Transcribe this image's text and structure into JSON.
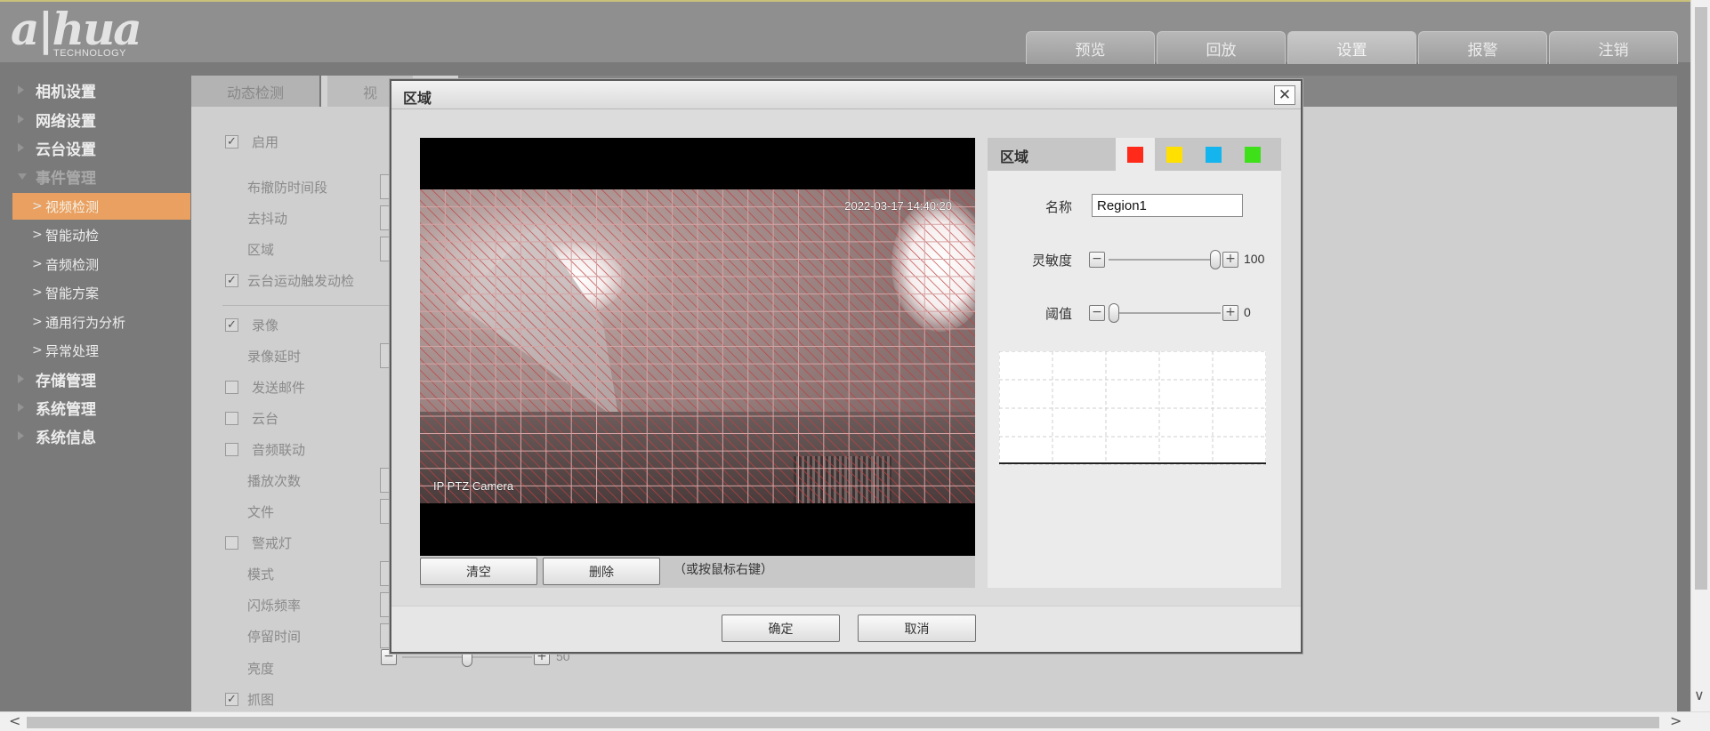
{
  "brand": {
    "wordmark": "a|hua",
    "subline": "TECHNOLOGY"
  },
  "top_tabs": [
    {
      "label": "预览",
      "active": false
    },
    {
      "label": "回放",
      "active": false
    },
    {
      "label": "设置",
      "active": true
    },
    {
      "label": "报警",
      "active": false
    },
    {
      "label": "注销",
      "active": false
    }
  ],
  "sidebar": {
    "groups": [
      {
        "label": "相机设置",
        "expanded": false
      },
      {
        "label": "网络设置",
        "expanded": false
      },
      {
        "label": "云台设置",
        "expanded": false
      },
      {
        "label": "事件管理",
        "expanded": true
      },
      {
        "label": "存储管理",
        "expanded": false
      },
      {
        "label": "系统管理",
        "expanded": false
      },
      {
        "label": "系统信息",
        "expanded": false
      }
    ],
    "event_items": [
      {
        "label": "视频检测",
        "active": true
      },
      {
        "label": "智能动检",
        "active": false
      },
      {
        "label": "音频检测",
        "active": false
      },
      {
        "label": "智能方案",
        "active": false
      },
      {
        "label": "通用行为分析",
        "active": false
      },
      {
        "label": "异常处理",
        "active": false
      }
    ]
  },
  "main": {
    "tabs": [
      {
        "label": "动态检测",
        "active": true
      },
      {
        "label": "视",
        "active": false
      }
    ],
    "form": {
      "enable": {
        "label": "启用",
        "checked": true
      },
      "schedule": {
        "label": "布撤防时间段"
      },
      "debounce": {
        "label": "去抖动"
      },
      "region": {
        "label": "区域"
      },
      "ptz_trigger": {
        "label": "云台运动触发动检",
        "checked": true
      },
      "record": {
        "label": "录像",
        "checked": true
      },
      "record_delay": {
        "label": "录像延时"
      },
      "send_email": {
        "label": "发送邮件",
        "checked": false
      },
      "ptz": {
        "label": "云台",
        "checked": false
      },
      "audio_link": {
        "label": "音频联动",
        "checked": false
      },
      "play_count": {
        "label": "播放次数"
      },
      "file": {
        "label": "文件"
      },
      "warning_light": {
        "label": "警戒灯",
        "checked": false
      },
      "mode": {
        "label": "模式"
      },
      "flash_freq": {
        "label": "闪烁频率"
      },
      "stay_time": {
        "label": "停留时间"
      },
      "brightness": {
        "label": "亮度",
        "value": 50,
        "value_text": "50",
        "level": 0.5
      },
      "snapshot": {
        "label": "抓图",
        "checked": true
      }
    }
  },
  "dialog": {
    "title": "区域",
    "close_glyph": "✕",
    "video": {
      "timestamp": "2022-03-17 14:40:20",
      "camera_label": "IP PTZ Camera",
      "grid": {
        "cols": 22,
        "rows": 18,
        "line_color": "#d6a3a3",
        "hatch_color": "#c04040"
      }
    },
    "buttons": {
      "clear": "清空",
      "delete": "删除",
      "hint": "（或按鼠标右键）"
    },
    "panel": {
      "title": "区域",
      "colors": [
        {
          "name": "red",
          "hex": "#ff2a1a",
          "active": true
        },
        {
          "name": "yellow",
          "hex": "#ffe000",
          "active": false
        },
        {
          "name": "cyan",
          "hex": "#14b4ee",
          "active": false
        },
        {
          "name": "green",
          "hex": "#3ee01a",
          "active": false
        }
      ],
      "name_label": "名称",
      "name_value": "Region1",
      "sensitivity": {
        "label": "灵敏度",
        "value": 100,
        "value_text": "100",
        "level": 1.0
      },
      "threshold": {
        "label": "阈值",
        "value": 0,
        "value_text": "0",
        "level": 0.0
      },
      "minus_glyph": "−",
      "plus_glyph": "+"
    },
    "footer": {
      "ok": "确定",
      "cancel": "取消"
    }
  },
  "scrollbars": {
    "left_glyph": "<",
    "right_glyph": ">",
    "down_glyph": "∨"
  }
}
